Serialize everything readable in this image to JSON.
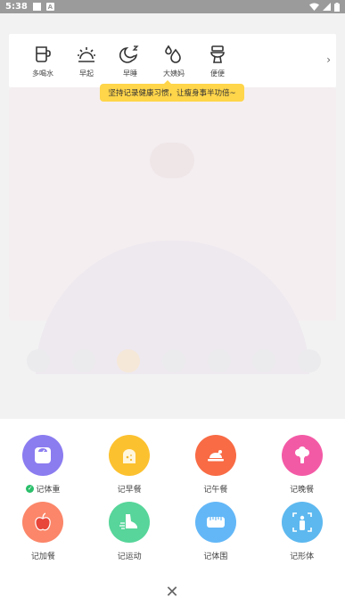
{
  "status_bar": {
    "time": "5:38"
  },
  "habits": {
    "items": [
      {
        "label": "多喝水",
        "icon": "cup-icon"
      },
      {
        "label": "早起",
        "icon": "sunrise-icon"
      },
      {
        "label": "早睡",
        "icon": "moon-icon"
      },
      {
        "label": "大姨妈",
        "icon": "droplets-icon"
      },
      {
        "label": "便便",
        "icon": "toilet-icon"
      }
    ],
    "more": "›"
  },
  "tooltip": {
    "text": "坚持记录健康习惯，让瘦身事半功倍~"
  },
  "actions": [
    {
      "label": "记体重",
      "icon": "scale-icon",
      "color": "#8b7cf0",
      "checked": true
    },
    {
      "label": "记早餐",
      "icon": "toast-icon",
      "color": "#fcc12f",
      "checked": false
    },
    {
      "label": "记午餐",
      "icon": "chicken-icon",
      "color": "#f86b45",
      "checked": false
    },
    {
      "label": "记晚餐",
      "icon": "broccoli-icon",
      "color": "#f35aa6",
      "checked": false
    },
    {
      "label": "记加餐",
      "icon": "apple-icon",
      "color": "#fb8669",
      "checked": false
    },
    {
      "label": "记运动",
      "icon": "shoe-icon",
      "color": "#57d59a",
      "checked": false
    },
    {
      "label": "记体围",
      "icon": "tape-icon",
      "color": "#63b7f7",
      "checked": false
    },
    {
      "label": "记形体",
      "icon": "body-icon",
      "color": "#5db8ef",
      "checked": false
    }
  ],
  "close": "✕"
}
